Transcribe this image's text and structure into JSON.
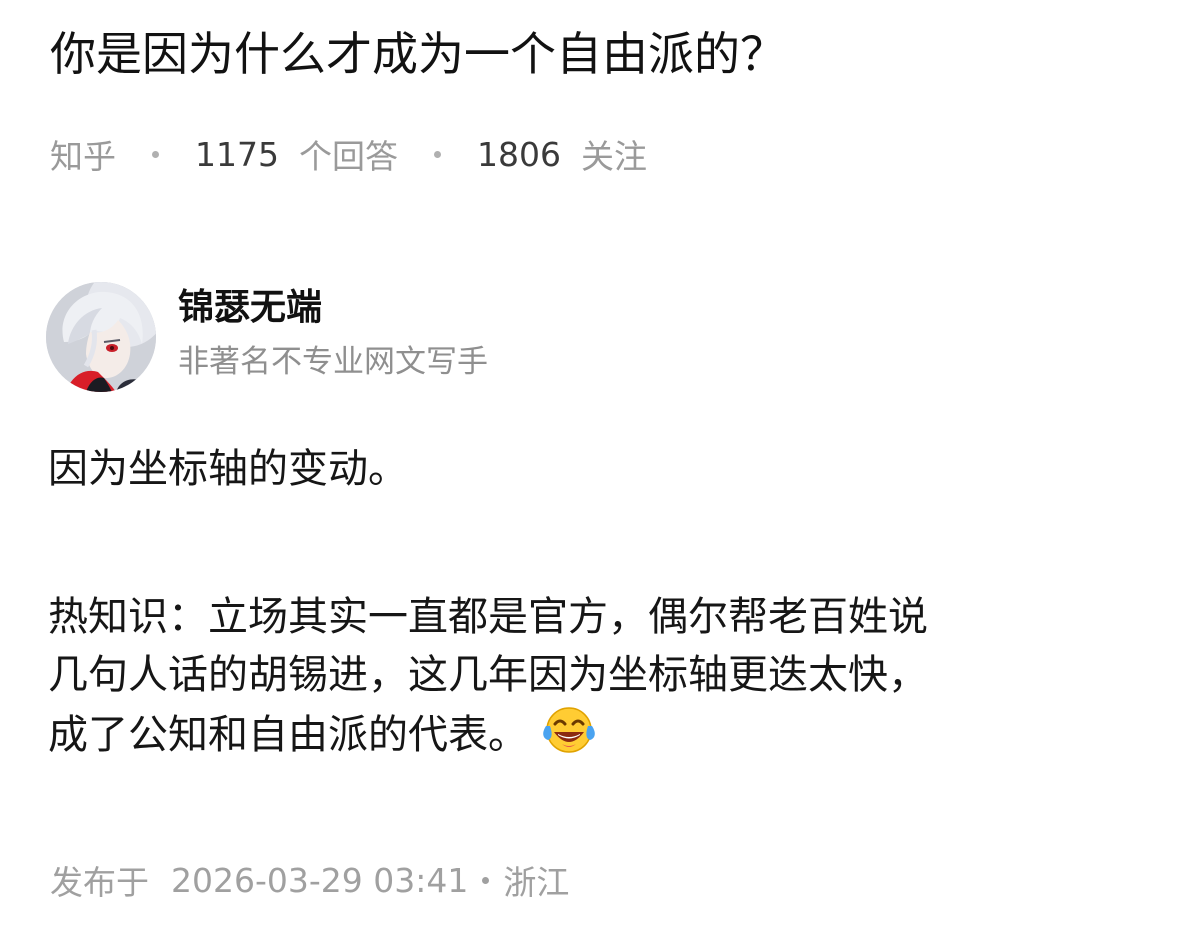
{
  "question": {
    "title": "你是因为什么才成为一个自由派的？",
    "source": "知乎",
    "answer_count": "1175",
    "answer_label": "个回答",
    "follow_count": "1806",
    "follow_label": "关注"
  },
  "author": {
    "name": "锦瑟无端",
    "bio": "非著名不专业网文写手",
    "avatar_icon": "anime-avatar"
  },
  "answer": {
    "paragraph1": "因为坐标轴的变动。",
    "paragraph2_lines": [
      "热知识：立场其实一直都是官方，偶尔帮老百姓说",
      "几句人话的胡锡进，这几年因为坐标轴更迭太快，",
      "成了公知和自由派的代表。"
    ],
    "emoji_icon": "tears-of-joy-emoji"
  },
  "footer": {
    "published_label": "发布于",
    "published_time": "2026-03-29 03:41",
    "location": "浙江"
  }
}
